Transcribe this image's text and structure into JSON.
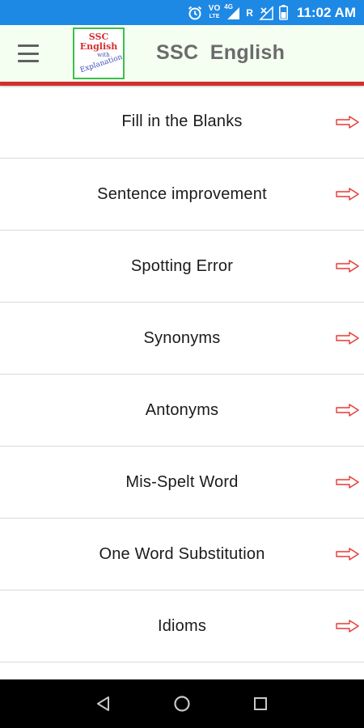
{
  "status_bar": {
    "time": "11:02 AM",
    "volte_line1": "VO",
    "volte_line2": "LTE",
    "network": "4G",
    "roaming": "R",
    "icons": [
      "alarm-icon",
      "volte-icon",
      "signal-icon",
      "signal-no-data-icon",
      "battery-icon"
    ]
  },
  "app_bar": {
    "title": "SSC  English",
    "menu_icon": "hamburger-menu-icon",
    "logo": {
      "line1": "SSC",
      "line2": "English",
      "line3": "with",
      "line4": "Explanation"
    }
  },
  "menu": {
    "items": [
      {
        "label": "Fill in the Blanks"
      },
      {
        "label": "Sentence improvement"
      },
      {
        "label": "Spotting Error"
      },
      {
        "label": "Synonyms"
      },
      {
        "label": "Antonyms"
      },
      {
        "label": "Mis-Spelt Word"
      },
      {
        "label": "One Word Substitution"
      },
      {
        "label": "Idioms"
      },
      {
        "label": ""
      }
    ],
    "item_icon": "right-arrow-icon"
  },
  "nav_bar": {
    "icons": [
      "back-icon",
      "home-icon",
      "recents-icon"
    ]
  },
  "colors": {
    "status_bar": "#1e88e5",
    "app_bar": "#f4fff1",
    "accent_line": "#d32f2f",
    "arrow": "#e53935",
    "nav_bar": "#000000"
  }
}
